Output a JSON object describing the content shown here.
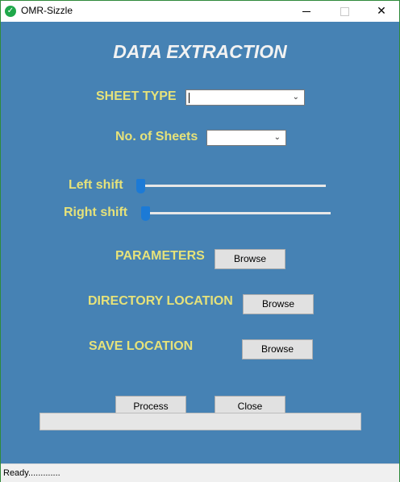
{
  "window": {
    "title": "OMR-Sizzle",
    "icon": "check-circle-icon",
    "minimize_glyph": "—",
    "maximize_glyph": "☐",
    "close_glyph": "✕"
  },
  "colors": {
    "background": "#4682b4",
    "label": "#e6e27a",
    "heading": "#f2f2f2",
    "slider_thumb": "#1c7ad6"
  },
  "main": {
    "heading": "DATA EXTRACTION",
    "sheet_type": {
      "label": "SHEET TYPE",
      "value": ""
    },
    "no_of_sheets": {
      "label": "No. of Sheets",
      "value": ""
    },
    "left_shift": {
      "label": "Left shift",
      "value": 0
    },
    "right_shift": {
      "label": "Right shift",
      "value": 0
    },
    "parameters": {
      "label": "PARAMETERS",
      "button": "Browse"
    },
    "directory_location": {
      "label": "DIRECTORY LOCATION",
      "button": "Browse"
    },
    "save_location": {
      "label": "SAVE LOCATION",
      "button": "Browse"
    },
    "process_button": "Process",
    "close_button": "Close",
    "progress": 0
  },
  "status": {
    "text": "Ready............."
  }
}
